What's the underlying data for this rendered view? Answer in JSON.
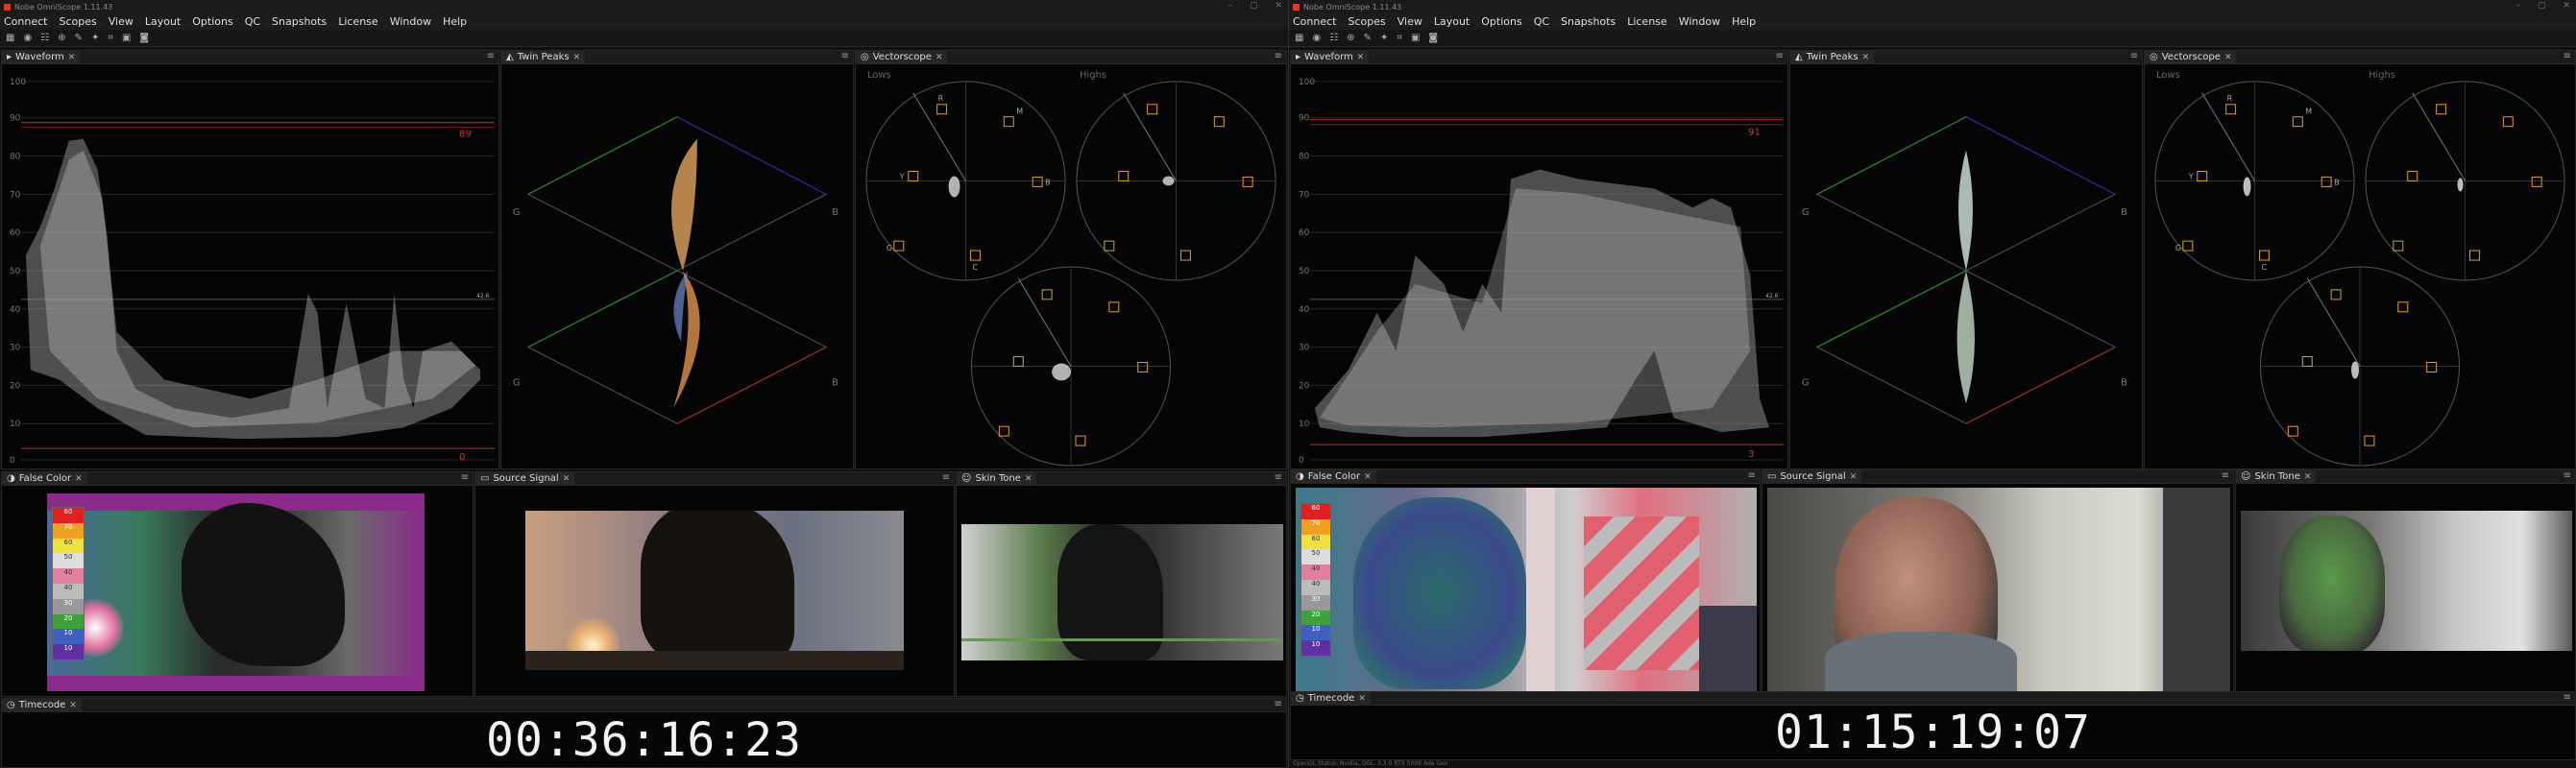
{
  "left": {
    "title": "Nobe OmniScope 1.11.43",
    "menu": [
      "Connect",
      "Scopes",
      "View",
      "Layout",
      "Options",
      "QC",
      "Snapshots",
      "License",
      "Window",
      "Help"
    ],
    "tabs": {
      "waveform": "Waveform",
      "twin_peaks": "Twin Peaks",
      "vectorscope": "Vectorscope",
      "false_color": "False Color",
      "source_signal": "Source Signal",
      "skin_tone": "Skin Tone",
      "timecode": "Timecode"
    },
    "waveform": {
      "ticks": [
        "100",
        "90",
        "80",
        "70",
        "60",
        "50",
        "40",
        "30",
        "20",
        "10",
        "0"
      ],
      "high_marker": "89",
      "low_marker": "0",
      "mid_value": "42.6"
    },
    "twin_peaks": {
      "g_left": "G",
      "g_right": "B"
    },
    "vectorscope": {
      "lows": "Lows",
      "highs": "Highs",
      "labels": {
        "r": "R",
        "mg": "M",
        "b": "B",
        "cy": "C",
        "g": "G",
        "yl": "Y"
      }
    },
    "false_color": {
      "scale": [
        "60",
        "70",
        "60",
        "50",
        "40",
        "40",
        "30",
        "20",
        "10",
        "10"
      ]
    },
    "timecode": "00:36:16:23"
  },
  "right": {
    "title": "Nobe OmniScope 1.11.43",
    "menu": [
      "Connect",
      "Scopes",
      "View",
      "Layout",
      "Options",
      "QC",
      "Snapshots",
      "License",
      "Window",
      "Help"
    ],
    "tabs": {
      "waveform": "Waveform",
      "twin_peaks": "Twin Peaks",
      "vectorscope": "Vectorscope",
      "false_color": "False Color",
      "source_signal": "Source Signal",
      "skin_tone": "Skin Tone",
      "timecode": "Timecode"
    },
    "waveform": {
      "ticks": [
        "100",
        "90",
        "80",
        "70",
        "60",
        "50",
        "40",
        "30",
        "20",
        "10",
        "0"
      ],
      "high_marker": "91",
      "low_marker": "3",
      "mid_value": "42.6"
    },
    "twin_peaks": {
      "g_left": "G",
      "g_right": "B"
    },
    "vectorscope": {
      "lows": "Lows",
      "highs": "Highs",
      "labels": {
        "r": "R",
        "mg": "M",
        "b": "B",
        "cy": "C",
        "g": "G",
        "yl": "Y"
      }
    },
    "false_color": {
      "scale": [
        "60",
        "70",
        "60",
        "50",
        "40",
        "40",
        "30",
        "20",
        "10",
        "10"
      ]
    },
    "timecode": "01:15:19:07",
    "status": "OpenGL Status: Nvidia, OGL, 3.3.0 RTX 5000 Ada Gen"
  },
  "colors": {
    "accent_red": "#d03030",
    "vector_orange": "#e0a030"
  }
}
